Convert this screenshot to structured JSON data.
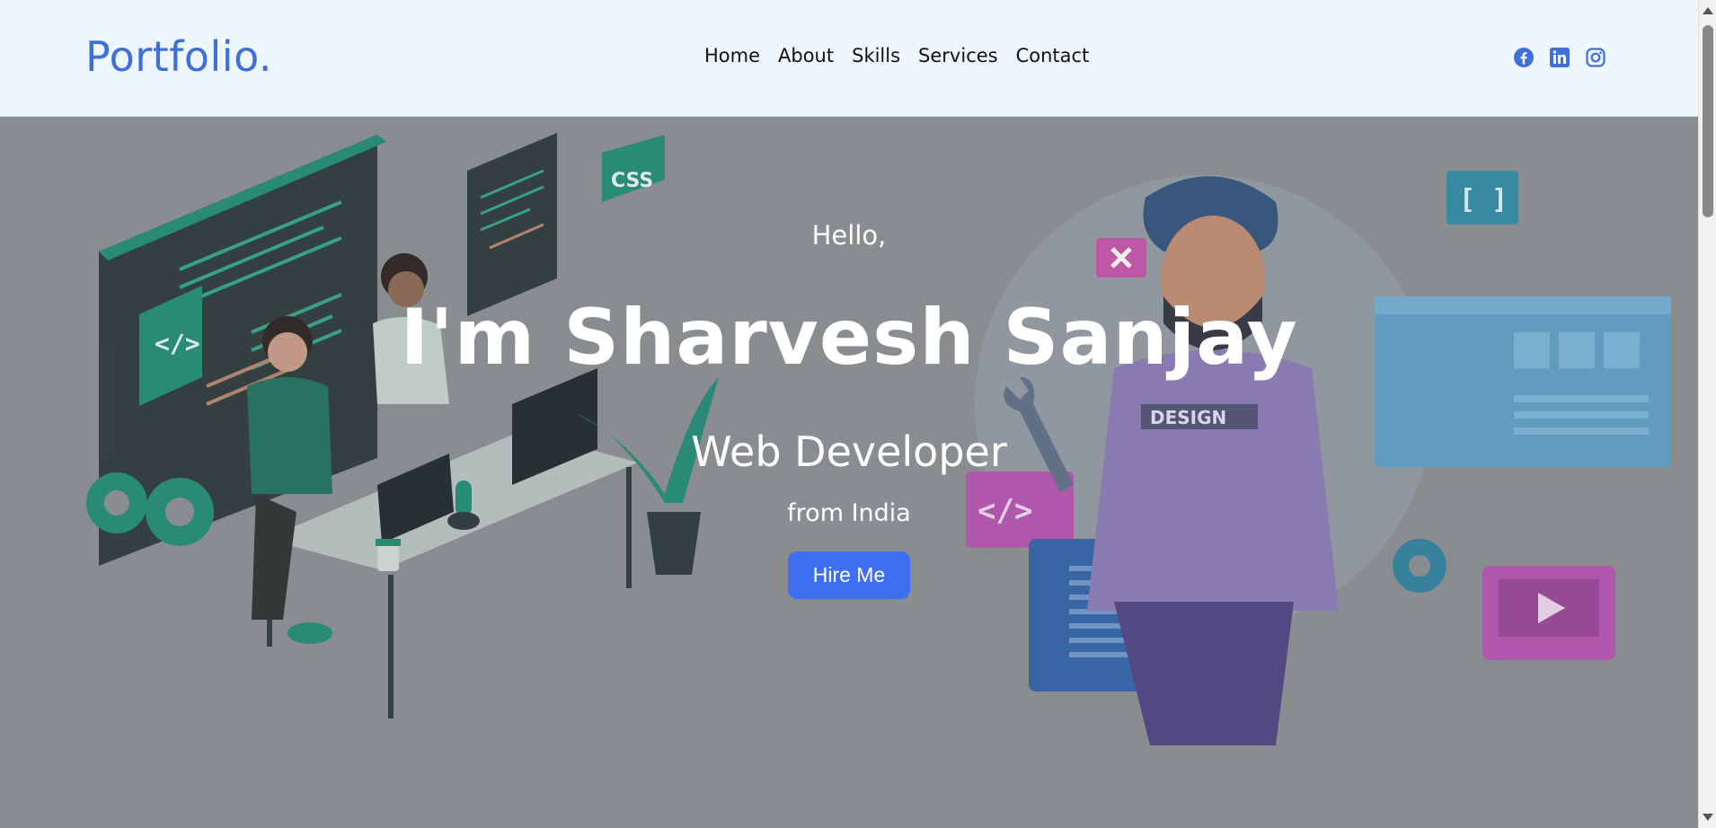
{
  "header": {
    "logo": "Portfolio.",
    "logo_color": "#3f6fdb",
    "nav": [
      {
        "label": "Home"
      },
      {
        "label": "About"
      },
      {
        "label": "Skills"
      },
      {
        "label": "Services"
      },
      {
        "label": "Contact"
      }
    ],
    "socials": [
      {
        "icon": "facebook-icon"
      },
      {
        "icon": "linkedin-icon"
      },
      {
        "icon": "instagram-icon"
      }
    ],
    "icon_color": "#3f6fdb"
  },
  "hero": {
    "greeting": "Hello,",
    "name": "I'm Sharvesh Sanjay",
    "role": "Web Developer",
    "location": "from India",
    "cta_label": "Hire Me",
    "cta_color": "#3d6ff0",
    "overlay_color": "#8a8d90"
  },
  "illustrations": {
    "left_badges": [
      "CSS",
      "</>"
    ],
    "right_badges": [
      "DESIGN",
      "[ ]",
      "</>"
    ]
  }
}
